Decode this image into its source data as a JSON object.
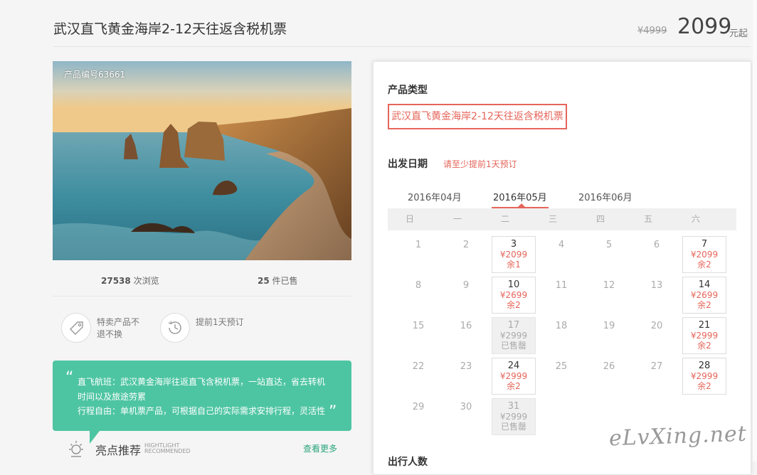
{
  "header": {
    "title": "武汉直飞黄金海岸2-12天往返含税机票",
    "old_price": "¥4999",
    "price": "2099",
    "price_unit": "元起"
  },
  "gallery": {
    "product_id": "产品编号63661"
  },
  "stats": {
    "views": "27538",
    "views_label": "次浏览",
    "sold": "25",
    "sold_label": "件已售"
  },
  "features": [
    {
      "icon": "tag-icon",
      "text": "特卖产品不退不换"
    },
    {
      "icon": "clock-history-icon",
      "text": "提前1天预订"
    }
  ],
  "bubble": {
    "line1": "直飞航班：武汉黄金海岸往返直飞含税机票，一站直达，省去转机时间以及旅途劳累",
    "line2": "行程自由：单机票产品，可根据自己的实际需求安排行程，灵活性"
  },
  "highlight": {
    "title": "亮点推荐",
    "sub1": "HIGHTLIGHT",
    "sub2": "RECOMMENDED",
    "more": "查看更多"
  },
  "panel": {
    "type_label": "产品类型",
    "type_value": "武汉直飞黄金海岸2-12天往返含税机票",
    "date_label": "出发日期",
    "date_note": "请至少提前1天预订",
    "next_label": "出行人数"
  },
  "calendar": {
    "months": [
      "2016年04月",
      "2016年05月",
      "2016年06月"
    ],
    "active_month": 1,
    "weekdays": [
      "日",
      "一",
      "二",
      "三",
      "四",
      "五",
      "六"
    ],
    "weeks": [
      [
        {
          "d": "1"
        },
        {
          "d": "2"
        },
        {
          "d": "3",
          "price": "¥2099",
          "stock": "余1"
        },
        {
          "d": "4"
        },
        {
          "d": "5"
        },
        {
          "d": "6"
        },
        {
          "d": "7",
          "price": "¥2099",
          "stock": "余2"
        }
      ],
      [
        {
          "d": "8"
        },
        {
          "d": "9"
        },
        {
          "d": "10",
          "price": "¥2699",
          "stock": "余2"
        },
        {
          "d": "11"
        },
        {
          "d": "12"
        },
        {
          "d": "13"
        },
        {
          "d": "14",
          "price": "¥2699",
          "stock": "余2"
        }
      ],
      [
        {
          "d": "15"
        },
        {
          "d": "16"
        },
        {
          "d": "17",
          "price": "¥2999",
          "stock": "已售罄",
          "soldout": true
        },
        {
          "d": "18"
        },
        {
          "d": "19"
        },
        {
          "d": "20"
        },
        {
          "d": "21",
          "price": "¥2999",
          "stock": "余2"
        }
      ],
      [
        {
          "d": "22"
        },
        {
          "d": "23"
        },
        {
          "d": "24",
          "price": "¥2999",
          "stock": "余2"
        },
        {
          "d": "25"
        },
        {
          "d": "26"
        },
        {
          "d": "27"
        },
        {
          "d": "28",
          "price": "¥2999",
          "stock": "余2"
        }
      ],
      [
        {
          "d": "29"
        },
        {
          "d": "30"
        },
        {
          "d": "31",
          "price": "¥2999",
          "stock": "已售罄",
          "soldout": true
        }
      ]
    ]
  },
  "watermark": "eLvXing.net",
  "colors": {
    "accent": "#e5655a",
    "bubble": "#4ec5a2",
    "link": "#2aa57e"
  }
}
